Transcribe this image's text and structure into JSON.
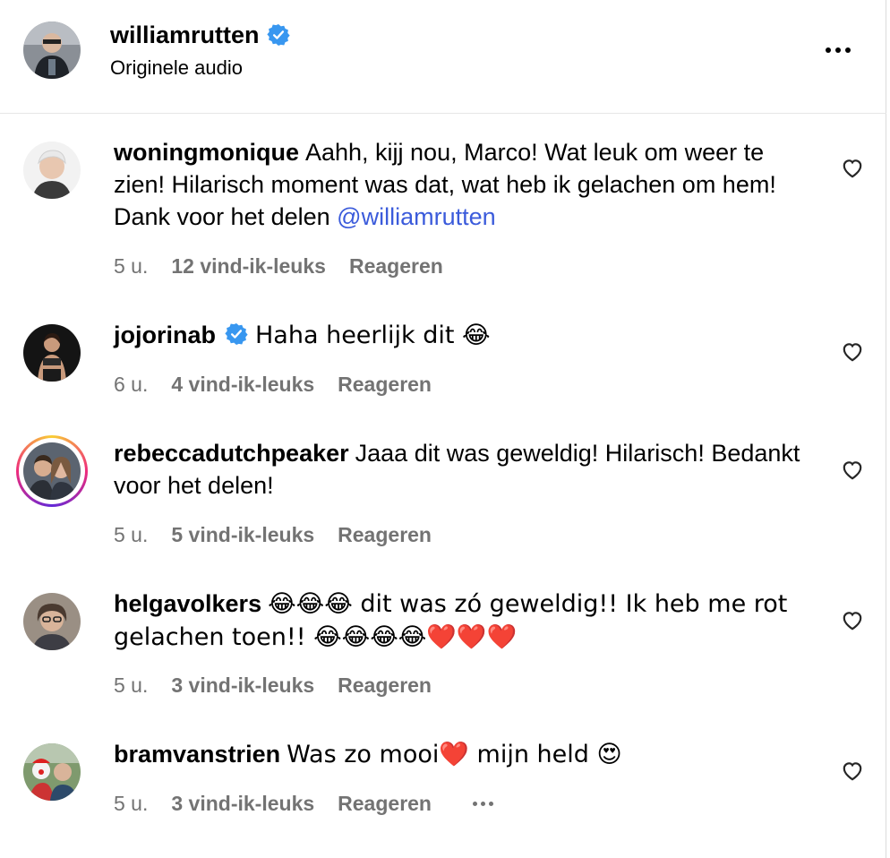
{
  "header": {
    "username": "williamrutten",
    "subtitle": "Originele audio"
  },
  "colors": {
    "verified_blue": "#3897f0",
    "mention_blue": "#3b5bdb",
    "meta_gray": "#737373",
    "divider": "#e6e6e6"
  },
  "icons": {
    "more": "more-horizontal-icon",
    "heart": "heart-outline-icon",
    "verified": "verified-badge-icon"
  },
  "comments": [
    {
      "username": "woningmonique",
      "text": "Aahh, kijj nou, Marco! Wat leuk om weer te zien! Hilarisch moment was dat, wat heb ik gelachen om hem! Dank voor het delen ",
      "mention": "@williamrutten",
      "time": "5 u.",
      "likes": "12 vind-ik-leuks",
      "reply": "Reageren"
    },
    {
      "username": "jojorinab",
      "verified": true,
      "text": "Haha heerlijk dit 😂",
      "time": "6 u.",
      "likes": "4 vind-ik-leuks",
      "reply": "Reageren"
    },
    {
      "username": "rebeccadutchpeaker",
      "text": "Jaaa dit was geweldig! Hilarisch! Bedankt voor het delen!",
      "time": "5 u.",
      "likes": "5 vind-ik-leuks",
      "reply": "Reageren"
    },
    {
      "username": "helgavolkers",
      "text": "😂😂😂 dit was zó geweldig!! Ik heb me rot gelachen toen!! 😂😂😂😂❤️❤️❤️",
      "time": "5 u.",
      "likes": "3 vind-ik-leuks",
      "reply": "Reageren"
    },
    {
      "username": "bramvanstrien",
      "text": "Was zo mooi❤️ mijn held 😍",
      "time": "5 u.",
      "likes": "3 vind-ik-leuks",
      "reply": "Reageren"
    }
  ]
}
